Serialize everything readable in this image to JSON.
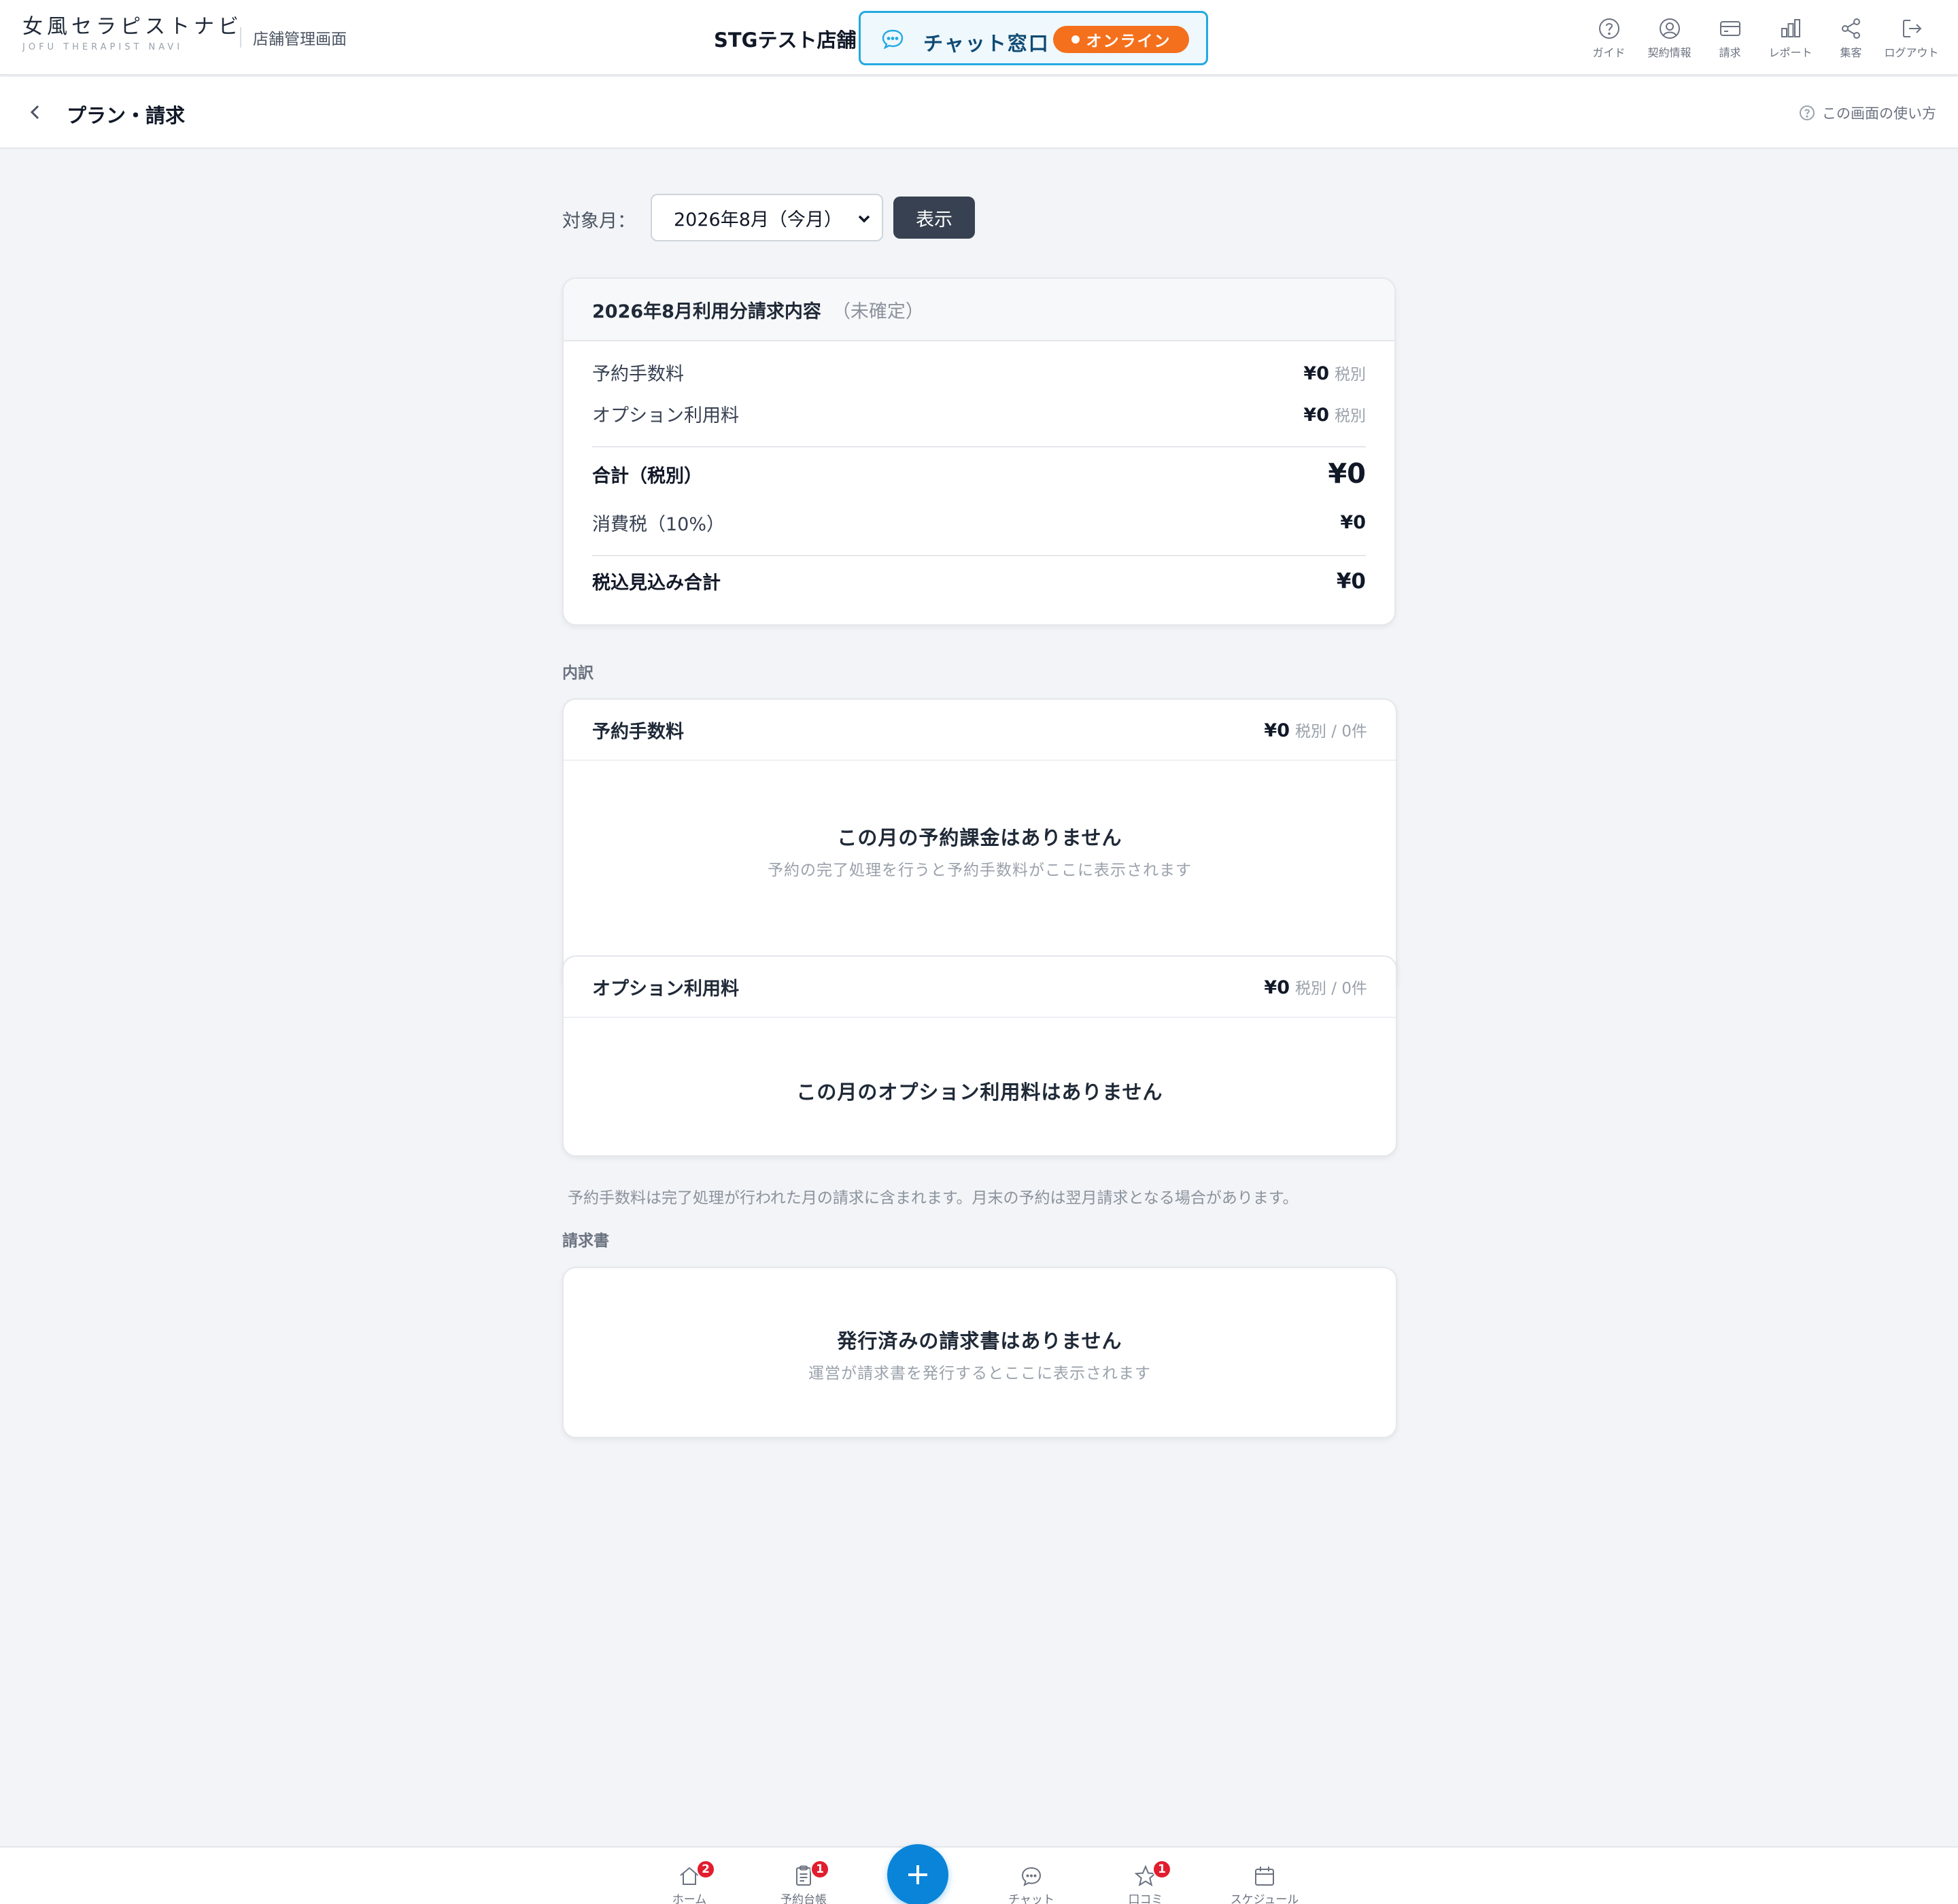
{
  "header": {
    "logo_main": "女風セラピストナビ",
    "logo_sub": "JOFU THERAPIST NAVI",
    "admin_label": "店舗管理画面",
    "store_name": "STGテスト店舗",
    "chat_label": "チャット窓口",
    "chat_status": "オンライン",
    "nav": [
      {
        "label": "ガイド",
        "icon": "help-circle-icon"
      },
      {
        "label": "契約情報",
        "icon": "user-circle-icon"
      },
      {
        "label": "請求",
        "icon": "credit-card-icon"
      },
      {
        "label": "レポート",
        "icon": "bar-chart-icon"
      },
      {
        "label": "集客",
        "icon": "share-icon"
      },
      {
        "label": "ログアウト",
        "icon": "logout-icon"
      }
    ]
  },
  "subheader": {
    "title": "プラン・請求",
    "help": "この画面の使い方"
  },
  "filter": {
    "label": "対象月：",
    "selected": "2026年8月（今月）",
    "button": "表示"
  },
  "summary": {
    "title": "2026年8月利用分請求内容",
    "status": "（未確定）",
    "rows": [
      {
        "label": "予約手数料",
        "amount": "¥0",
        "tax": "税別"
      },
      {
        "label": "オプション利用料",
        "amount": "¥0",
        "tax": "税別"
      }
    ],
    "subtotal_label": "合計（税別）",
    "subtotal": "¥0",
    "tax_label": "消費税（10%）",
    "tax": "¥0",
    "total_label": "税込見込み合計",
    "total": "¥0"
  },
  "breakdown": {
    "label": "内訳",
    "booking": {
      "title": "予約手数料",
      "amount": "¥0",
      "meta": "税別 / 0件",
      "empty": "この月の予約課金はありません",
      "empty_sub": "予約の完了処理を行うと予約手数料がここに表示されます"
    },
    "option": {
      "title": "オプション利用料",
      "amount": "¥0",
      "meta": "税別 / 0件",
      "empty": "この月のオプション利用料はありません"
    },
    "note": "予約手数料は完了処理が行われた月の請求に含まれます。月末の予約は翌月請求となる場合があります。"
  },
  "invoices": {
    "label": "請求書",
    "empty": "発行済みの請求書はありません",
    "empty_sub": "運営が請求書を発行するとここに表示されます"
  },
  "bottom_nav": [
    {
      "label": "ホーム",
      "badge": "2",
      "icon": "home-icon"
    },
    {
      "label": "予約台帳",
      "badge": "1",
      "icon": "clipboard-icon"
    },
    {
      "label": "チャット",
      "badge": "",
      "icon": "chat-icon"
    },
    {
      "label": "口コミ",
      "badge": "1",
      "icon": "star-icon"
    },
    {
      "label": "スケジュール",
      "badge": "",
      "icon": "calendar-icon"
    }
  ],
  "colors": {
    "accent": "#0a84d8",
    "online": "#f4701c",
    "chat_border": "#23a9e1",
    "badge": "#e11d2e",
    "button_dark": "#374151"
  }
}
